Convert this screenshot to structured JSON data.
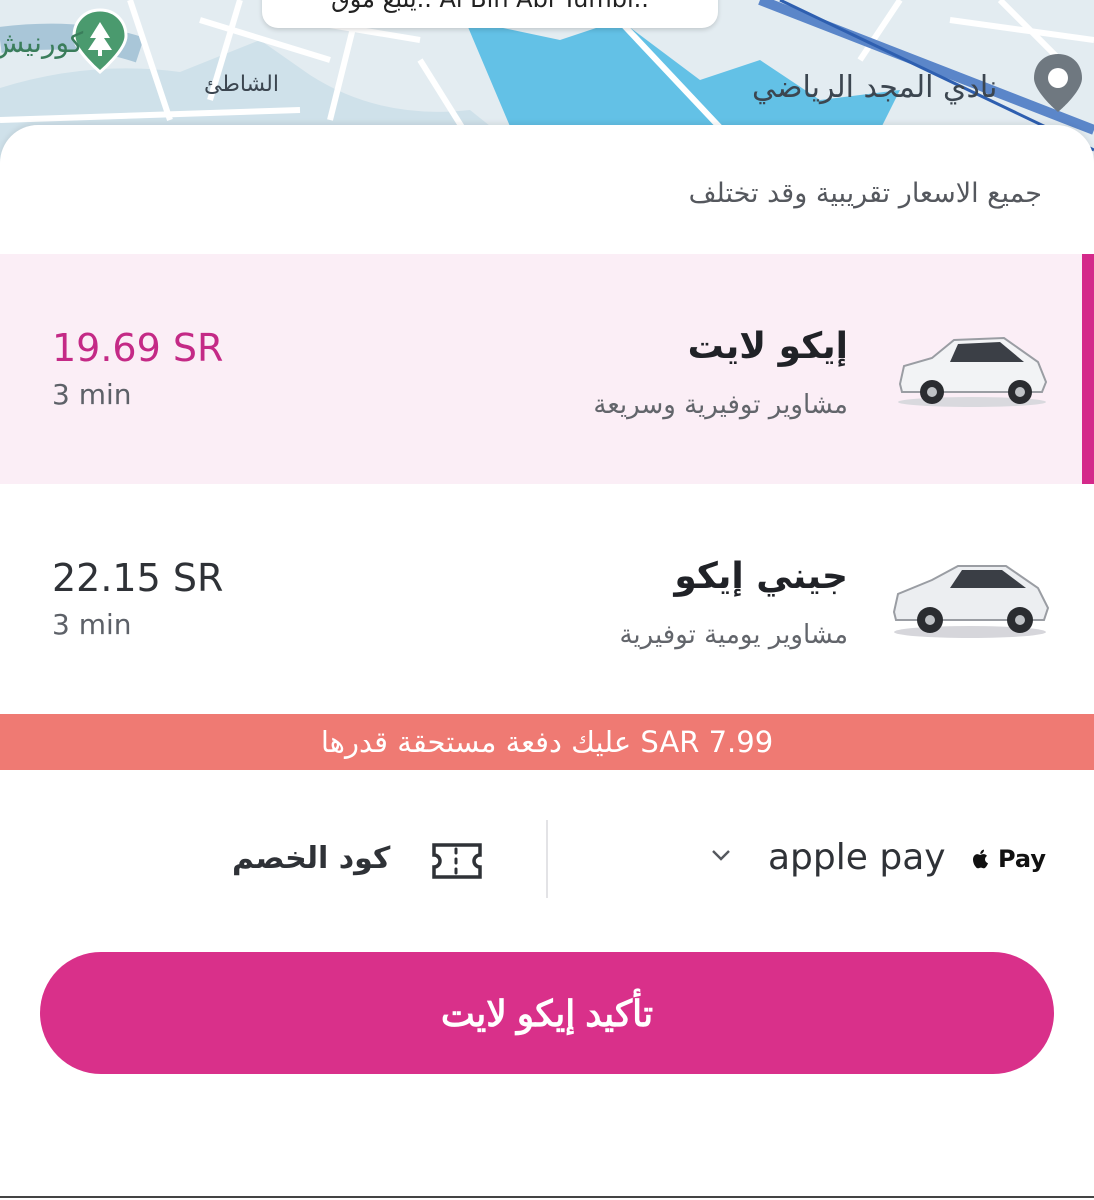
{
  "map": {
    "top_card_text": "يتبع موق.. Al Bin Abi Tumbi..",
    "poi_left_label": "كورنيش",
    "district_label": "الشاطئ",
    "poi_right_label": "نادي المجد الرياضي"
  },
  "sheet": {
    "disclaimer": "جميع الاسعار تقريبية وقد تختلف"
  },
  "rides": [
    {
      "name": "إيكو لايت",
      "description": "مشاوير توفيرية وسريعة",
      "price": "19.69 SR",
      "eta": "3 min",
      "selected": true
    },
    {
      "name": "جيني إيكو",
      "description": "مشاوير يومية توفيرية",
      "price": "22.15 SR",
      "eta": "3 min",
      "selected": false
    }
  ],
  "due_banner": "عليك دفعة مستحقة قدرها SAR 7.99",
  "payment": {
    "apple_badge": "Pay",
    "method_label": "apple pay",
    "discount_label": "كود الخصم"
  },
  "confirm_button": "تأكيد إيكو لايت",
  "colors": {
    "accent": "#d4298a",
    "selected_bg": "#fbeef6",
    "due_banner": "#ef7a73",
    "confirm": "#d9308a"
  }
}
